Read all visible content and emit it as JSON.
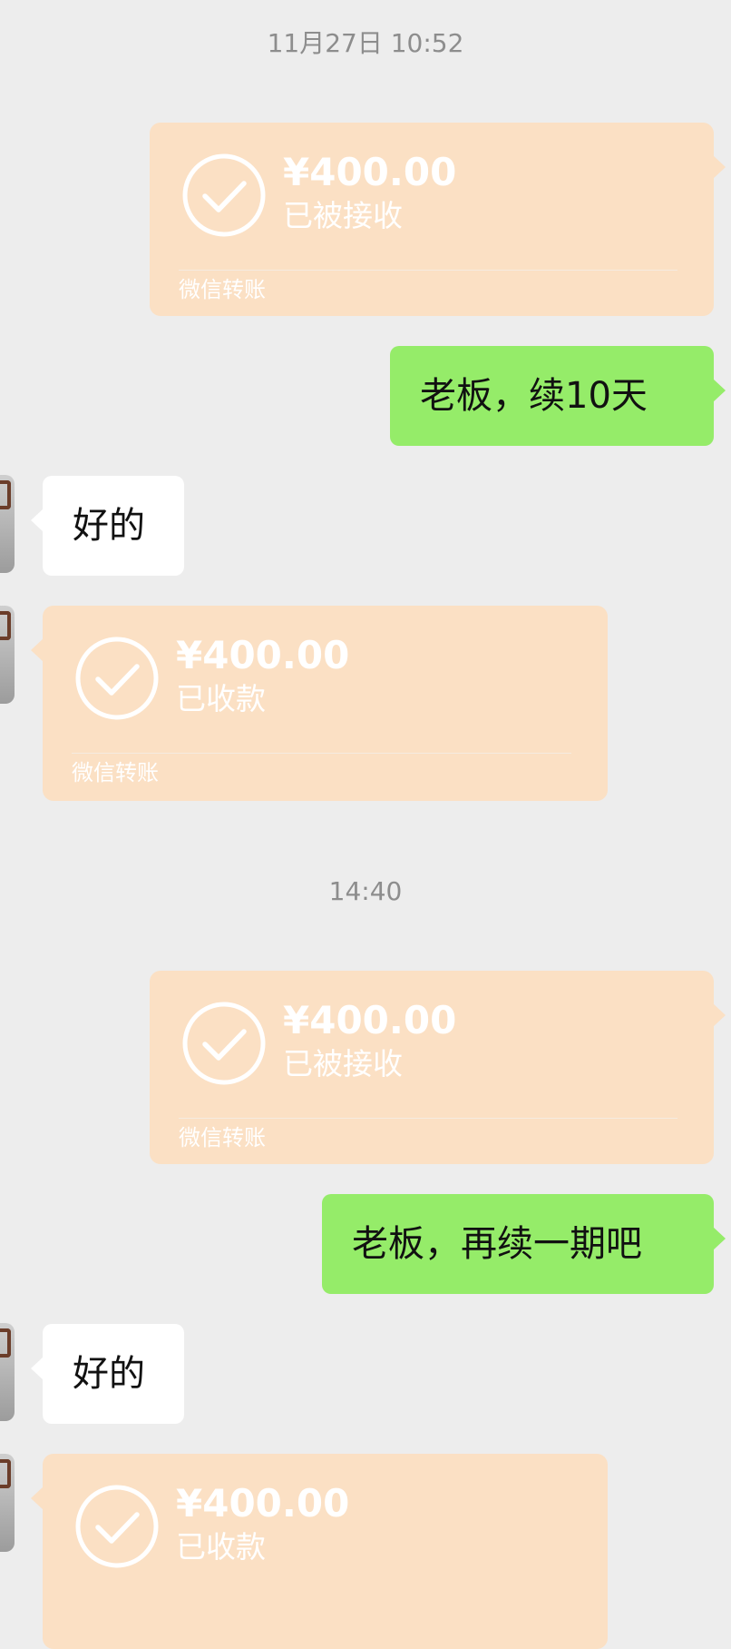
{
  "timestamps": [
    "11月27日 10:52",
    "14:40"
  ],
  "transfer": {
    "amount": "¥400.00",
    "status_sent": "已被接收",
    "status_received": "已收款",
    "label": "微信转账",
    "icon": "check-circle-icon"
  },
  "messages": {
    "m1": "老板，续10天",
    "m2": "好的",
    "m3": "老板，再续一期吧",
    "m4": "好的"
  },
  "colors": {
    "background": "#ededed",
    "transfer_card": "#fbe0c4",
    "sent_bubble": "#95ec69",
    "received_bubble": "#ffffff",
    "timestamp": "#8d8d8d"
  }
}
